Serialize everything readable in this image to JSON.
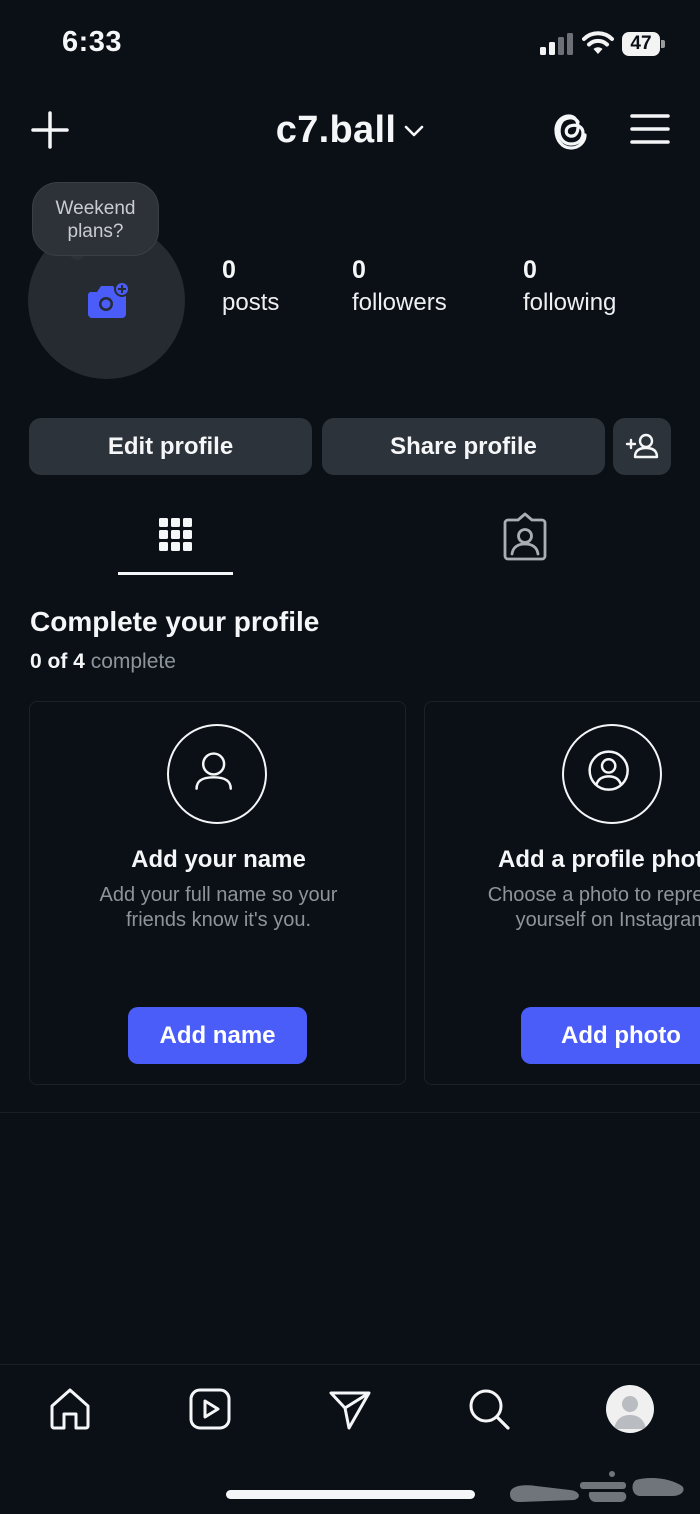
{
  "status_bar": {
    "time": "6:33",
    "battery": "47"
  },
  "header": {
    "username": "c7.ball"
  },
  "avatar": {
    "note": "Weekend plans?"
  },
  "stats": [
    {
      "count": "0",
      "label": "posts"
    },
    {
      "count": "0",
      "label": "followers"
    },
    {
      "count": "0",
      "label": "following"
    }
  ],
  "actions": {
    "edit_profile": "Edit profile",
    "share_profile": "Share profile"
  },
  "complete_profile": {
    "title": "Complete your profile",
    "progress_done": "0 of 4",
    "progress_suffix": "complete",
    "cards": [
      {
        "title": "Add your name",
        "desc_line1": "Add your full name so your",
        "desc_line2": "friends know it's you.",
        "button": "Add name"
      },
      {
        "title": "Add a profile photo",
        "desc_line1": "Choose a photo to represent",
        "desc_line2": "yourself on Instagram.",
        "button": "Add photo"
      }
    ]
  },
  "colors": {
    "background": "#0b1017",
    "button_dark": "#2d333a",
    "accent_blue": "#4a5df9",
    "text_secondary": "#8e949b"
  },
  "icons": {
    "top": [
      "plus-icon",
      "chevron-down-icon",
      "threads-icon",
      "menu-icon"
    ],
    "tabs": [
      "grid-icon",
      "tagged-icon"
    ],
    "bottom_nav": [
      "home-icon",
      "reels-icon",
      "send-icon",
      "search-icon",
      "profile-avatar"
    ]
  }
}
